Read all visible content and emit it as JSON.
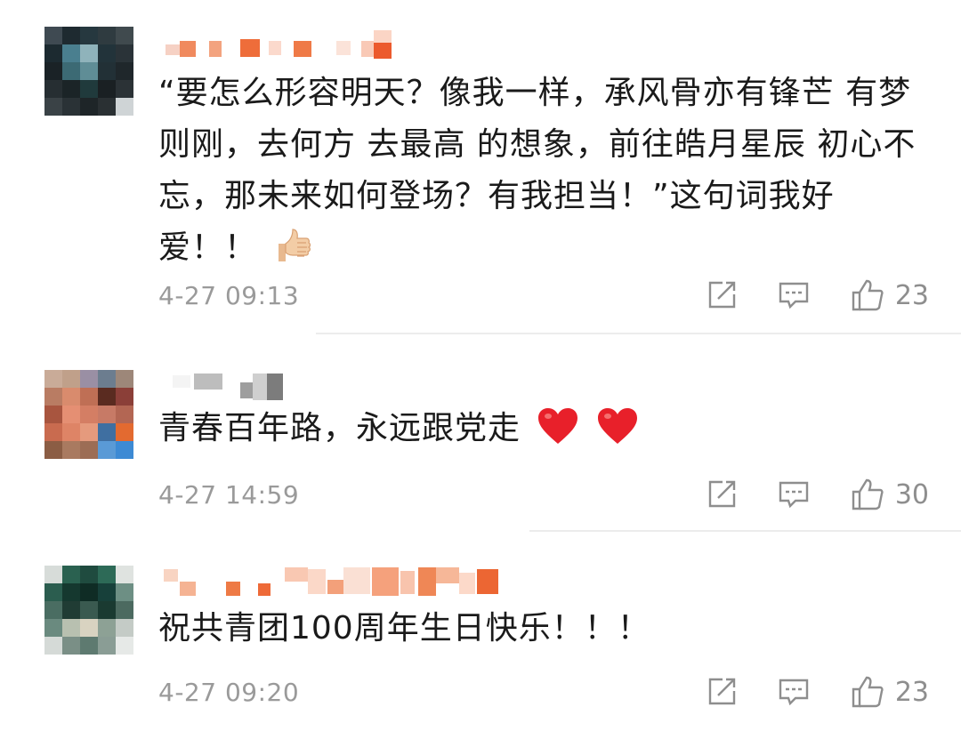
{
  "comments": [
    {
      "text": "“要怎么形容明天？像我一样，承风骨亦有锋芒 有梦则刚，去何方 去最高 的想象，前往皓月星辰 初心不忘，那未来如何登场？有我担当！”这句词我好爱！！",
      "emoji": "thumbs-up",
      "time": "4-27 09:13",
      "likes": "23"
    },
    {
      "text": "青春百年路，永远跟党走",
      "emoji": "red-heart",
      "time": "4-27 14:59",
      "likes": "30"
    },
    {
      "text": "祝共青团100周年生日快乐！！！",
      "emoji": "",
      "time": "4-27 09:20",
      "likes": "23"
    }
  ],
  "colors": {
    "text": "#1a1a1a",
    "meta": "#9a9a9a",
    "icon": "#8e8e8e",
    "divider": "#ececec",
    "heart": "#e8202a"
  },
  "icons": [
    "share-icon",
    "reply-icon",
    "like-icon"
  ]
}
